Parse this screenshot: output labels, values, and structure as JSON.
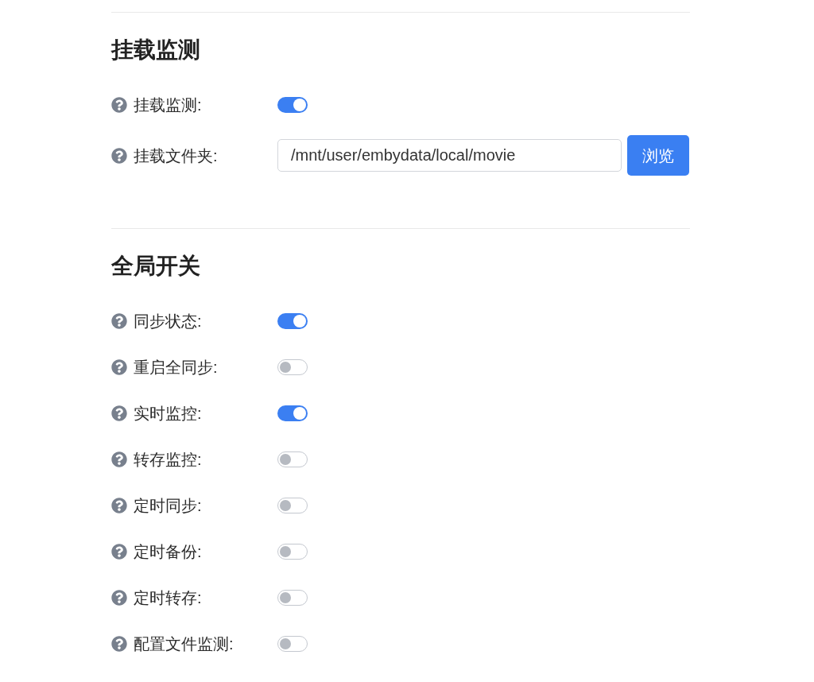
{
  "sections": [
    {
      "title": "挂载监测",
      "fields": [
        {
          "kind": "toggle",
          "label": "挂载监测:",
          "on": true
        },
        {
          "kind": "path",
          "label": "挂载文件夹:",
          "value": "/mnt/user/embydata/local/movie",
          "button": "浏览"
        }
      ]
    },
    {
      "title": "全局开关",
      "fields": [
        {
          "kind": "toggle",
          "label": "同步状态:",
          "on": true
        },
        {
          "kind": "toggle",
          "label": "重启全同步:",
          "on": false
        },
        {
          "kind": "toggle",
          "label": "实时监控:",
          "on": true
        },
        {
          "kind": "toggle",
          "label": "转存监控:",
          "on": false
        },
        {
          "kind": "toggle",
          "label": "定时同步:",
          "on": false
        },
        {
          "kind": "toggle",
          "label": "定时备份:",
          "on": false
        },
        {
          "kind": "toggle",
          "label": "定时转存:",
          "on": false
        },
        {
          "kind": "toggle",
          "label": "配置文件监测:",
          "on": false
        }
      ]
    }
  ]
}
